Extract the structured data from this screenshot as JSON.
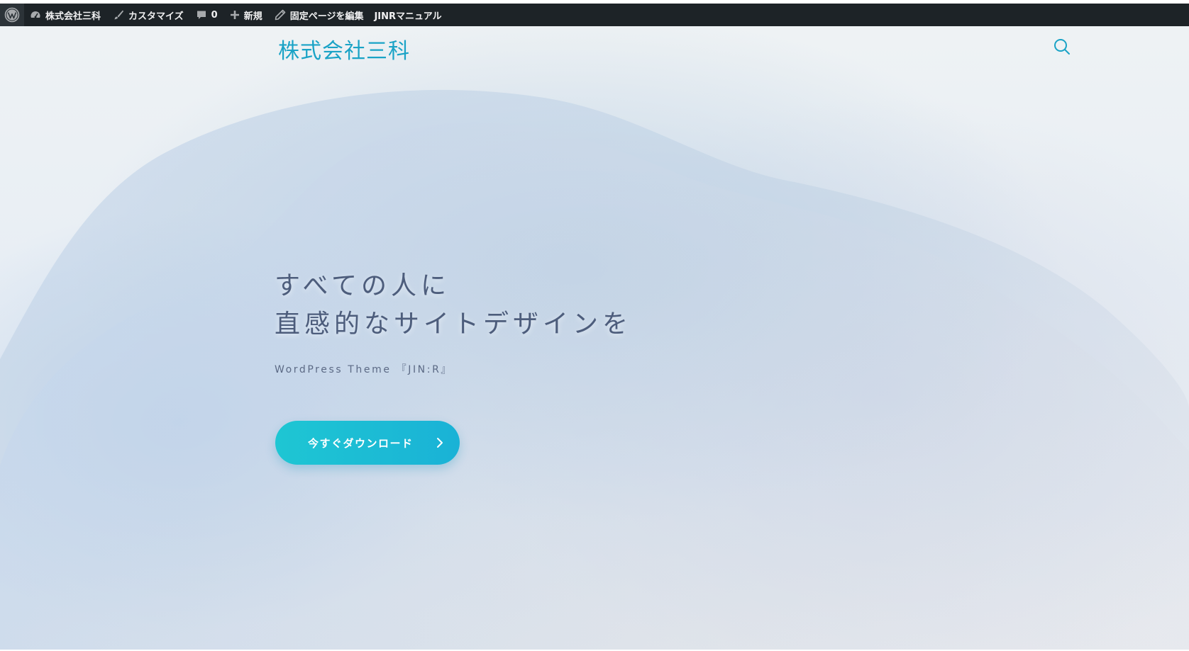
{
  "adminbar": {
    "items": [
      {
        "icon": "dashboard-icon",
        "label": "株式会社三科"
      },
      {
        "icon": "brush-icon",
        "label": "カスタマイズ"
      },
      {
        "icon": "comment-icon",
        "label": "0"
      },
      {
        "icon": "plus-icon",
        "label": "新規"
      },
      {
        "icon": "pencil-icon",
        "label": "固定ページを編集"
      },
      {
        "icon": "",
        "label": "JINRマニュアル"
      }
    ]
  },
  "header": {
    "site_title": "株式会社三科",
    "search_icon": "search-icon"
  },
  "hero": {
    "title_line1": "すべての人に",
    "title_line2": "直感的なサイトデザインを",
    "subtitle": "WordPress Theme 『JIN:R』",
    "cta_label": "今すぐダウンロード",
    "cta_icon": "chevron-right-icon"
  },
  "colors": {
    "admin_bar": "#1d2327",
    "accent": "#1aa3c6",
    "heading": "#4d5d7c",
    "button_start": "#1ec6d3",
    "button_end": "#1ab2d6"
  }
}
